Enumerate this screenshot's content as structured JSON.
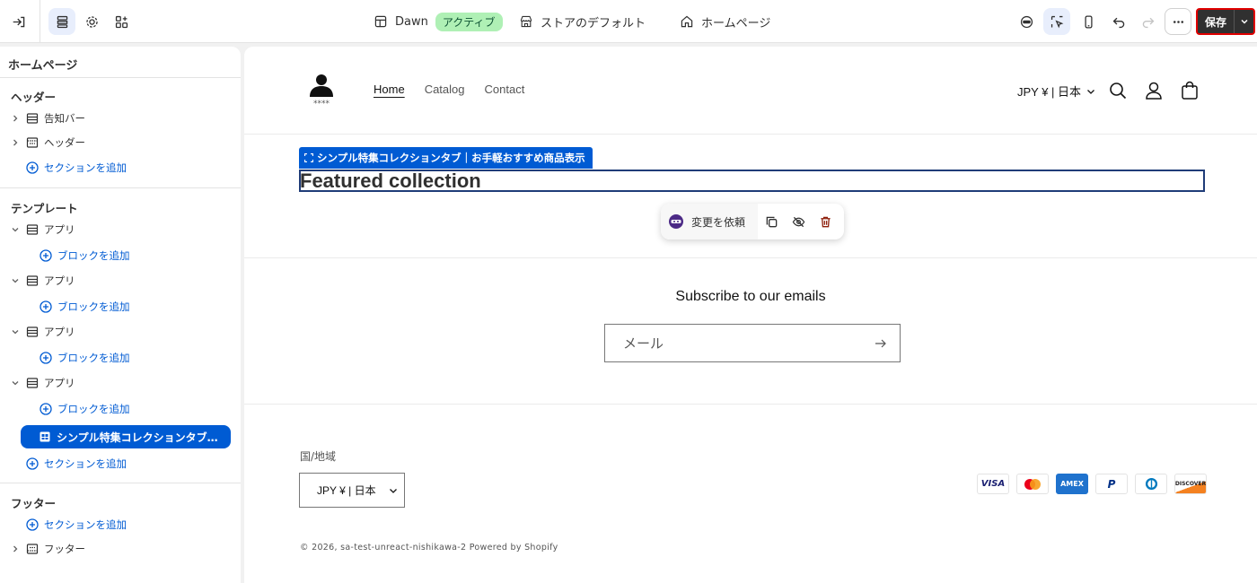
{
  "topbar": {
    "theme_name": "Dawn",
    "theme_status": "アクティブ",
    "store_default": "ストアのデフォルト",
    "page_selector": "ホームページ",
    "save_label": "保存"
  },
  "sidebar": {
    "title": "ホームページ",
    "header_group": {
      "heading": "ヘッダー",
      "items": [
        {
          "label": "告知バー"
        },
        {
          "label": "ヘッダー"
        }
      ],
      "add_section": "セクションを追加"
    },
    "template_group": {
      "heading": "テンプレート",
      "apps": [
        {
          "label": "アプリ",
          "add_block": "ブロックを追加"
        },
        {
          "label": "アプリ",
          "add_block": "ブロックを追加"
        },
        {
          "label": "アプリ",
          "add_block": "ブロックを追加"
        },
        {
          "label": "アプリ",
          "add_block": "ブロックを追加"
        }
      ],
      "selected_section": "シンプル特集コレクションタブ｜お手軽おすすめ商品表示",
      "add_section": "セクションを追加"
    },
    "footer_group": {
      "heading": "フッター",
      "add_section": "セクションを追加",
      "items": [
        {
          "label": "フッター"
        }
      ]
    }
  },
  "preview": {
    "logo_text": "****",
    "nav": [
      "Home",
      "Catalog",
      "Contact"
    ],
    "currency": "JPY ¥ | 日本",
    "section_label": "シンプル特集コレクションタブ｜お手軽おすすめ商品表示",
    "featured_title": "Featured collection",
    "toolbar_request": "変更を依頼",
    "subscribe_heading": "Subscribe to our emails",
    "email_placeholder": "メール",
    "region_label": "国/地域",
    "region_value": "JPY ¥ | 日本",
    "payments": [
      "VISA",
      "",
      "AMEX",
      "P",
      "",
      "DISCOVER"
    ],
    "copyright": "© 2026, sa-test-unreact-nishikawa-2 Powered by Shopify"
  },
  "colors": {
    "accent": "#005bd3",
    "save_bg": "#303030",
    "active_badge": "#aff0b5"
  }
}
